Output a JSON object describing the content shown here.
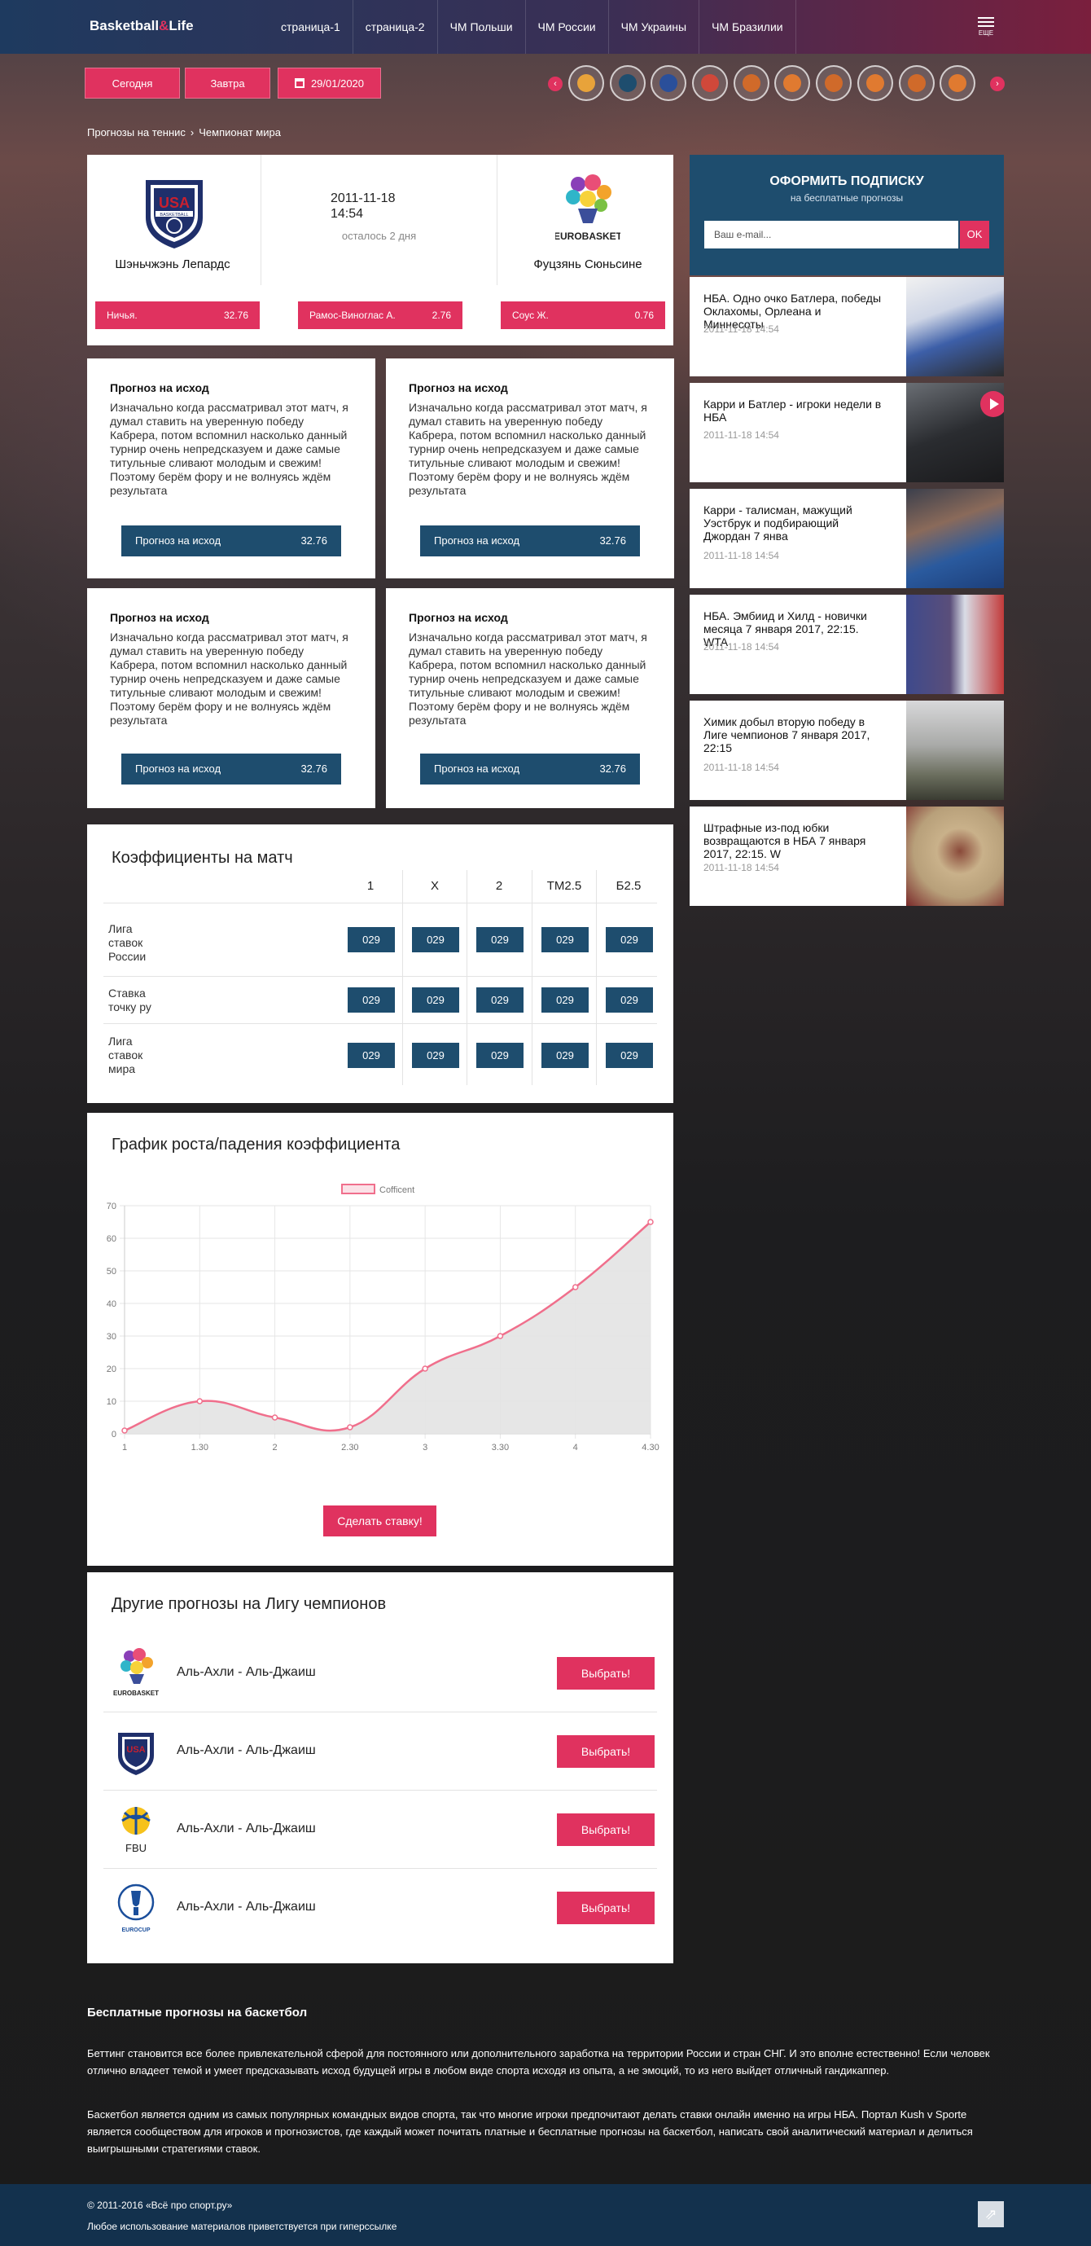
{
  "header": {
    "logo_left": "Basketball",
    "logo_amp": "&",
    "logo_right": "Life",
    "nav": [
      "страница-1",
      "страница-2",
      "ЧМ Польши",
      "ЧМ России",
      "ЧМ Украины",
      "ЧМ Бразилии"
    ],
    "more_label": "ЕЩЕ"
  },
  "dates": {
    "today": "Сегодня",
    "tomorrow": "Завтра",
    "picked": "29/01/2020"
  },
  "breadcrumbs": [
    "Прогнозы на теннис",
    "Чемпионат мира"
  ],
  "match": {
    "team1": "Шэньчжэнь Лепардс",
    "team2": "Фуцзянь Сюньсине",
    "date": "2011-11-18",
    "time": "14:54",
    "left": "осталось 2 дня",
    "odds": [
      {
        "label": "Ничья.",
        "value": "32.76"
      },
      {
        "label": "Рамос-Виноглас А.",
        "value": "2.76"
      },
      {
        "label": "Соус Ж.",
        "value": "0.76"
      }
    ],
    "logo_text1": "USA",
    "logo_text1b": "BASKETBALL",
    "logo_text2": "EUROBASKET"
  },
  "predictions": [
    {
      "title": "Прогноз на исход",
      "text": "Изначально когда рассматривал этот матч, я думал ставить на уверенную победу Кабрера, потом вспомнил насколько данный турнир очень непредсказуем и даже самые титульные сливают молодым и свежим! Поэтому берём фору и не волнуясь ждём результата",
      "button": "Прогноз на исход",
      "value": "32.76"
    },
    {
      "title": "Прогноз на исход",
      "text": "Изначально когда рассматривал этот матч, я думал ставить на уверенную победу Кабрера, потом вспомнил насколько данный турнир очень непредсказуем и даже самые титульные сливают молодым и свежим! Поэтому берём фору и не волнуясь ждём результата",
      "button": "Прогноз на исход",
      "value": "32.76"
    },
    {
      "title": "Прогноз на исход",
      "text": "Изначально когда рассматривал этот матч, я думал ставить на уверенную победу Кабрера, потом вспомнил насколько данный турнир очень непредсказуем и даже самые титульные сливают молодым и свежим! Поэтому берём фору и не волнуясь ждём результата",
      "button": "Прогноз на исход",
      "value": "32.76"
    },
    {
      "title": "Прогноз на исход",
      "text": "Изначально когда рассматривал этот матч, я думал ставить на уверенную победу Кабрера, потом вспомнил насколько данный турнир очень непредсказуем и даже самые титульные сливают молодым и свежим! Поэтому берём фору и не волнуясь ждём результата",
      "button": "Прогноз на исход",
      "value": "32.76"
    }
  ],
  "odds_table": {
    "title": "Коэффициенты на матч",
    "headers": [
      "1",
      "X",
      "2",
      "ТМ2.5",
      "Б2.5"
    ],
    "rows": [
      {
        "name": "Лига ставок России",
        "values": [
          "029",
          "029",
          "029",
          "029",
          "029"
        ]
      },
      {
        "name": "Ставка точку ру",
        "values": [
          "029",
          "029",
          "029",
          "029",
          "029"
        ]
      },
      {
        "name": "Лига ставок мира",
        "values": [
          "029",
          "029",
          "029",
          "029",
          "029"
        ]
      }
    ]
  },
  "chart_section": {
    "title": "График роста/падения коэффициента",
    "button": "Сделать ставку!"
  },
  "chart_data": {
    "type": "line",
    "title": "",
    "xlabel": "",
    "ylabel": "",
    "legend": "Cofficent",
    "legend_position": "top-center",
    "categories": [
      "1",
      "1.30",
      "2",
      "2.30",
      "3",
      "3.30",
      "4",
      "4.30"
    ],
    "series": [
      {
        "name": "Cofficent",
        "values": [
          1,
          10,
          5,
          2,
          20,
          30,
          45,
          65
        ]
      }
    ],
    "ylim": [
      0,
      70
    ],
    "yticks": [
      0,
      10,
      20,
      30,
      40,
      50,
      60,
      70
    ],
    "grid": true,
    "colors": {
      "line": "#f06f8c",
      "fill": "#e3e3e3"
    }
  },
  "others": {
    "title": "Другие прогнозы на Лигу чемпионов",
    "items": [
      {
        "label": "Аль-Ахли - Аль-Джаиш",
        "button": "Выбрать!",
        "logo": "eurobasket-logo",
        "logo_text": "EUROBASKET"
      },
      {
        "label": "Аль-Ахли - Аль-Джаиш",
        "button": "Выбрать!",
        "logo": "usa-basketball-logo",
        "logo_text": "USA"
      },
      {
        "label": "Аль-Ахли - Аль-Джаиш",
        "button": "Выбрать!",
        "logo": "fbu-logo",
        "logo_text": "FBU"
      },
      {
        "label": "Аль-Ахли - Аль-Джаиш",
        "button": "Выбрать!",
        "logo": "eurocup-logo",
        "logo_text": "EUROCUP"
      }
    ]
  },
  "subscribe": {
    "title": "ОФОРМИТЬ ПОДПИСКУ",
    "subtitle": "на бесплатные прогнозы",
    "placeholder": "Ваш e-mail...",
    "ok": "OK"
  },
  "news": [
    {
      "title": "НБА. Одно очко Батлера, победы Оклахомы, Орлеана и Миннесоты",
      "date": "2011-11-18 14:54"
    },
    {
      "title": "Карри и Батлер - игроки недели в НБА",
      "date": "2011-11-18 14:54"
    },
    {
      "title": "Карри - талисман, мажущий Уэстбрук и подбирающий Джордан 7 янва",
      "date": "2011-11-18 14:54"
    },
    {
      "title": "НБА. Эмбиид и Хилд - новички месяца 7 января 2017, 22:15. WTA",
      "date": "2011-11-18 14:54"
    },
    {
      "title": "Химик добыл вторую победу в Лиге чемпионов 7 января 2017, 22:15",
      "date": "2011-11-18 14:54"
    },
    {
      "title": "Штрафные из-под юбки возвращаются в НБА 7 января 2017, 22:15. W",
      "date": "2011-11-18 14:54"
    }
  ],
  "seo": {
    "title": "Бесплатные прогнозы на баскетбол",
    "p1": "Беттинг становится все более привлекательной сферой для постоянного или дополнительного заработка на территории России и стран СНГ. И это вполне естественно! Если человек отлично владеет темой и умеет предсказывать исход будущей игры в любом виде спорта исходя из опыта, а не эмоций, то из него выйдет отличный гандикаппер.",
    "p2": "Баскетбол является одним из самых популярных командных видов спорта, так что многие игроки предпочитают делать ставки онлайн именно на игры НБА. Портал Kush v Sporte является сообществом для игроков и прогнозистов, где каждый может почитать платные и бесплатные прогнозы на баскетбол, написать свой аналитический материал и делиться выигрышными стратегиями ставок."
  },
  "footer": {
    "copyright": "© 2011-2016 «Всё про спорт.ру»",
    "note": "Любое использование материалов приветствуется при гиперссылке",
    "up": "⇗"
  }
}
